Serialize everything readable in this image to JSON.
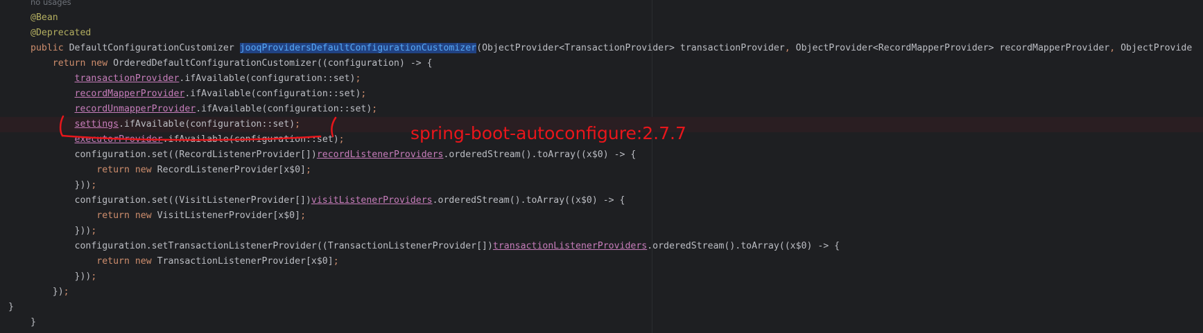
{
  "editor": {
    "usage_hint": "no usages",
    "lines": [
      {
        "segments": [
          {
            "t": "@Bean",
            "c": "ann"
          }
        ]
      },
      {
        "segments": [
          {
            "t": "@Deprecated",
            "c": "ann"
          }
        ]
      },
      {
        "segments": [
          {
            "t": "public ",
            "c": "kw"
          },
          {
            "t": "DefaultConfigurationCustomizer ",
            "c": ""
          },
          {
            "t": "jooqProvidersDefaultConfigurationCustomizer",
            "c": "fn-sel"
          },
          {
            "t": "(ObjectProvider<TransactionProvider> transactionProvider",
            "c": ""
          },
          {
            "t": ", ",
            "c": "kw"
          },
          {
            "t": "ObjectProvider<RecordMapperProvider> recordMapperProvider",
            "c": ""
          },
          {
            "t": ", ",
            "c": "kw"
          },
          {
            "t": "ObjectProvide",
            "c": ""
          }
        ]
      },
      {
        "segments": [
          {
            "t": "    return new ",
            "c": "kw"
          },
          {
            "t": "OrderedDefaultConfigurationCustomizer((configuration) -> {",
            "c": ""
          }
        ]
      },
      {
        "segments": [
          {
            "t": "        ",
            "c": ""
          },
          {
            "t": "transactionProvider",
            "c": "fld"
          },
          {
            "t": ".ifAvailable(configuration::set)",
            "c": ""
          },
          {
            "t": ";",
            "c": "kw"
          }
        ]
      },
      {
        "segments": [
          {
            "t": "        ",
            "c": ""
          },
          {
            "t": "recordMapperProvider",
            "c": "fld"
          },
          {
            "t": ".ifAvailable(configuration::set)",
            "c": ""
          },
          {
            "t": ";",
            "c": "kw"
          }
        ]
      },
      {
        "segments": [
          {
            "t": "        ",
            "c": ""
          },
          {
            "t": "recordUnmapperProvider",
            "c": "fld"
          },
          {
            "t": ".ifAvailable(configuration::set)",
            "c": ""
          },
          {
            "t": ";",
            "c": "kw"
          }
        ]
      },
      {
        "segments": [
          {
            "t": "        ",
            "c": ""
          },
          {
            "t": "settings",
            "c": "fld"
          },
          {
            "t": ".ifAvailable(configuration::set)",
            "c": ""
          },
          {
            "t": ";",
            "c": "kw"
          }
        ]
      },
      {
        "segments": [
          {
            "t": "        ",
            "c": ""
          },
          {
            "t": "executorProvider",
            "c": "fld"
          },
          {
            "t": ".ifAvailable(configuration::set)",
            "c": ""
          },
          {
            "t": ";",
            "c": "kw"
          }
        ]
      },
      {
        "segments": [
          {
            "t": "        configuration.set((RecordListenerProvider[])",
            "c": ""
          },
          {
            "t": "recordListenerProviders",
            "c": "fld"
          },
          {
            "t": ".orderedStream().toArray((x$0) -> {",
            "c": ""
          }
        ]
      },
      {
        "segments": [
          {
            "t": "            return new ",
            "c": "kw"
          },
          {
            "t": "RecordListenerProvider[x$0]",
            "c": ""
          },
          {
            "t": ";",
            "c": "kw"
          }
        ]
      },
      {
        "segments": [
          {
            "t": "        }))",
            "c": ""
          },
          {
            "t": ";",
            "c": "kw"
          }
        ]
      },
      {
        "segments": [
          {
            "t": "        configuration.set((VisitListenerProvider[])",
            "c": ""
          },
          {
            "t": "visitListenerProviders",
            "c": "fld"
          },
          {
            "t": ".orderedStream().toArray((x$0) -> {",
            "c": ""
          }
        ]
      },
      {
        "segments": [
          {
            "t": "            return new ",
            "c": "kw"
          },
          {
            "t": "VisitListenerProvider[x$0]",
            "c": ""
          },
          {
            "t": ";",
            "c": "kw"
          }
        ]
      },
      {
        "segments": [
          {
            "t": "        }))",
            "c": ""
          },
          {
            "t": ";",
            "c": "kw"
          }
        ]
      },
      {
        "segments": [
          {
            "t": "        configuration.setTransactionListenerProvider((TransactionListenerProvider[])",
            "c": ""
          },
          {
            "t": "transactionListenerProviders",
            "c": "fld"
          },
          {
            "t": ".orderedStream().toArray((x$0) -> {",
            "c": ""
          }
        ]
      },
      {
        "segments": [
          {
            "t": "            return new ",
            "c": "kw"
          },
          {
            "t": "TransactionListenerProvider[x$0]",
            "c": ""
          },
          {
            "t": ";",
            "c": "kw"
          }
        ]
      },
      {
        "segments": [
          {
            "t": "        }))",
            "c": ""
          },
          {
            "t": ";",
            "c": "kw"
          }
        ]
      },
      {
        "segments": [
          {
            "t": "    })",
            "c": ""
          },
          {
            "t": ";",
            "c": "kw"
          }
        ]
      },
      {
        "segments": [
          {
            "t": "}",
            "c": ""
          }
        ]
      },
      {
        "segments": [
          {
            "t": "}",
            "c": ""
          }
        ]
      }
    ],
    "highlighted_line_index": 7
  },
  "annotation": {
    "text": "spring-boot-autoconfigure:2.7.7",
    "color": "#e8161b"
  }
}
